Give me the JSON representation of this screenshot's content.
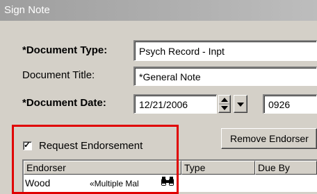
{
  "window": {
    "title": "Sign Note"
  },
  "document_type": {
    "label": "*Document Type:",
    "value": "Psych Record - Inpt"
  },
  "document_title": {
    "label": "Document Title:",
    "value": "*General Note"
  },
  "document_date": {
    "label": "*Document Date:",
    "date_value": "12/21/2006",
    "time_value": "0926"
  },
  "remove_button": {
    "label": "Remove Endorser"
  },
  "endorsement": {
    "checkbox_checked": true,
    "checkbox_mark": "✓",
    "label": "Request Endorsement"
  },
  "grid": {
    "columns": [
      "Endorser",
      "Type",
      "Due By"
    ],
    "row": {
      "endorser": "Wood",
      "type": "«Multiple Mal"
    }
  },
  "icons": {
    "spinner": "up-down-arrows-icon",
    "dropdown": "chevron-down-icon",
    "lookup": "binoculars-icon"
  },
  "colors": {
    "highlight": "#e00000",
    "window_bg": "#d4d0c8"
  }
}
